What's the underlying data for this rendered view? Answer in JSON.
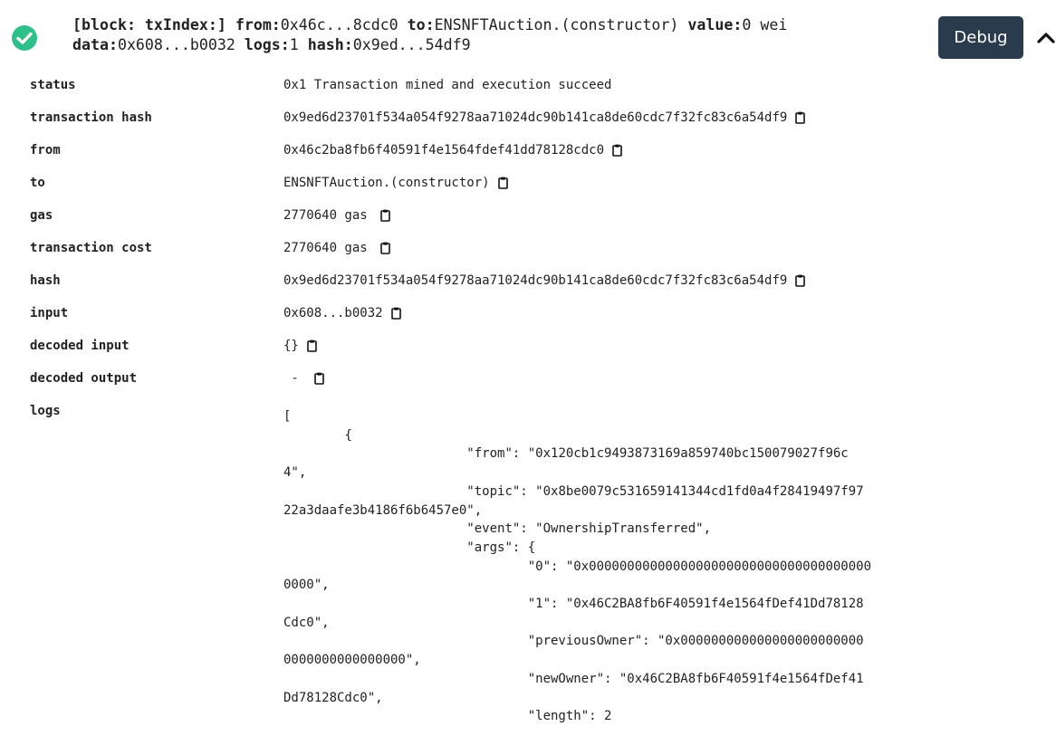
{
  "summary": {
    "block_label": "[block: txIndex:]",
    "from_label": "from:",
    "from_value": "0x46c...8cdc0",
    "to_label": "to:",
    "to_value": "ENSNFTAuction.(constructor)",
    "value_label": "value:",
    "value_value": "0 wei",
    "data_label": "data:",
    "data_value": "0x608...b0032",
    "logs_label": "logs:",
    "logs_value": "1",
    "hash_label": "hash:",
    "hash_value": "0x9ed...54df9"
  },
  "debug_button": {
    "label": "Debug"
  },
  "rows": [
    {
      "label": "status",
      "value": "0x1 Transaction mined and execution succeed",
      "copy": false
    },
    {
      "label": "transaction hash",
      "value": "0x9ed6d23701f534a054f9278aa71024dc90b141ca8de60cdc7f32fc83c6a54df9",
      "copy": true
    },
    {
      "label": "from",
      "value": "0x46c2ba8fb6f40591f4e1564fdef41dd78128cdc0",
      "copy": true
    },
    {
      "label": "to",
      "value": "ENSNFTAuction.(constructor)",
      "copy": true
    },
    {
      "label": "gas",
      "value": "2770640 gas",
      "copy": true
    },
    {
      "label": "transaction cost",
      "value": "2770640 gas",
      "copy": true
    },
    {
      "label": "hash",
      "value": "0x9ed6d23701f534a054f9278aa71024dc90b141ca8de60cdc7f32fc83c6a54df9",
      "copy": true
    },
    {
      "label": "input",
      "value": "0x608...b0032",
      "copy": true
    },
    {
      "label": "decoded input",
      "value": "{}",
      "copy": true
    },
    {
      "label": "decoded output",
      "value": " - ",
      "copy": true
    },
    {
      "label": "logs",
      "value": "",
      "copy": false
    }
  ],
  "logs_text": "[\n\t{\n\t\t\t\"from\": \"0x120cb1c9493873169a859740bc150079027f96c\n4\",\n\t\t\t\"topic\": \"0x8be0079c531659141344cd1fd0a4f28419497f97\n22a3daafe3b4186f6b6457e0\",\n\t\t\t\"event\": \"OwnershipTransferred\",\n\t\t\t\"args\": {\n\t\t\t\t\"0\": \"0x0000000000000000000000000000000000000\n0000\",\n\t\t\t\t\"1\": \"0x46C2BA8fb6F40591f4e1564fDef41Dd78128\nCdc0\",\n\t\t\t\t\"previousOwner\": \"0x000000000000000000000000\n0000000000000000\",\n\t\t\t\t\"newOwner\": \"0x46C2BA8fb6F40591f4e1564fDef41\nDd78128Cdc0\",\n\t\t\t\t\"length\": 2",
  "colors": {
    "success": "#2ebf8b",
    "button_bg": "#2a3b4d",
    "text": "#222222"
  },
  "icons": [
    "check-circle-icon",
    "chevron-up-icon",
    "clipboard-icon"
  ]
}
